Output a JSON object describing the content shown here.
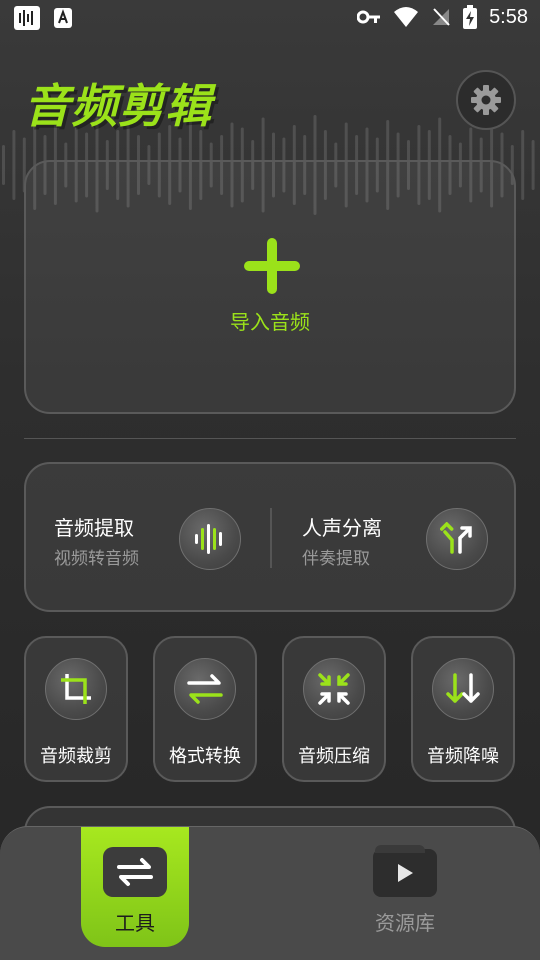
{
  "status_bar": {
    "time": "5:58"
  },
  "header": {
    "title": "音频剪辑"
  },
  "import": {
    "label": "导入音频"
  },
  "combo": {
    "left": {
      "title": "音频提取",
      "subtitle": "视频转音频"
    },
    "right": {
      "title": "人声分离",
      "subtitle": "伴奏提取"
    }
  },
  "tools": [
    {
      "label": "音频裁剪",
      "icon": "crop-icon"
    },
    {
      "label": "格式转换",
      "icon": "convert-arrows-icon"
    },
    {
      "label": "音频压缩",
      "icon": "compress-icon"
    },
    {
      "label": "音频降噪",
      "icon": "denoise-arrows-icon"
    }
  ],
  "bottom_nav": {
    "tools_label": "工具",
    "library_label": "资源库"
  },
  "colors": {
    "accent": "#9be21a",
    "background": "#2e2e2e",
    "card_border": "#5a5a5a"
  }
}
